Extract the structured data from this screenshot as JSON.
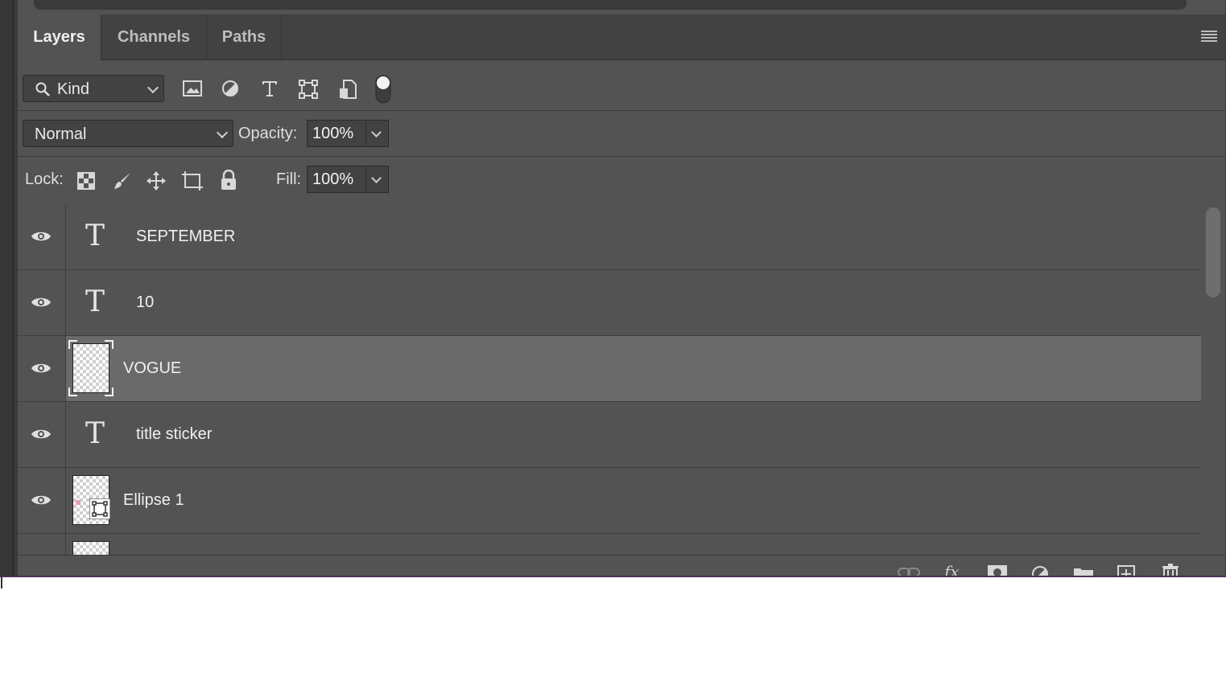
{
  "tabs": [
    {
      "label": "Layers",
      "active": true
    },
    {
      "label": "Channels",
      "active": false
    },
    {
      "label": "Paths",
      "active": false
    }
  ],
  "filter": {
    "kind_label": "Kind",
    "icons": [
      "image-filter-icon",
      "adjustment-filter-icon",
      "type-filter-icon",
      "shape-filter-icon",
      "smart-object-filter-icon",
      "filter-toggle-icon"
    ]
  },
  "blend": {
    "mode": "Normal",
    "opacity_label": "Opacity:",
    "opacity_value": "100%"
  },
  "lock": {
    "label": "Lock:",
    "icons": [
      "lock-transparent-pixels-icon",
      "lock-image-pixels-icon",
      "lock-position-icon",
      "lock-artboard-icon",
      "lock-all-icon"
    ],
    "fill_label": "Fill:",
    "fill_value": "100%"
  },
  "layers": [
    {
      "name": "SEPTEMBER",
      "kind": "type",
      "visible": true,
      "selected": false
    },
    {
      "name": "10",
      "kind": "type",
      "visible": true,
      "selected": false
    },
    {
      "name": "VOGUE",
      "kind": "smart-object",
      "visible": true,
      "selected": true
    },
    {
      "name": "title sticker",
      "kind": "type",
      "visible": true,
      "selected": false
    },
    {
      "name": "Ellipse 1",
      "kind": "shape",
      "visible": true,
      "selected": false
    }
  ],
  "footer_icons": [
    "link-layers-icon",
    "fx-icon",
    "add-mask-icon",
    "adjustment-layer-icon",
    "new-group-icon",
    "new-layer-icon",
    "delete-layer-icon"
  ],
  "colors": {
    "panel_bg": "#535353",
    "selected_row": "#6a6a6a",
    "tab_bar": "#424242"
  }
}
